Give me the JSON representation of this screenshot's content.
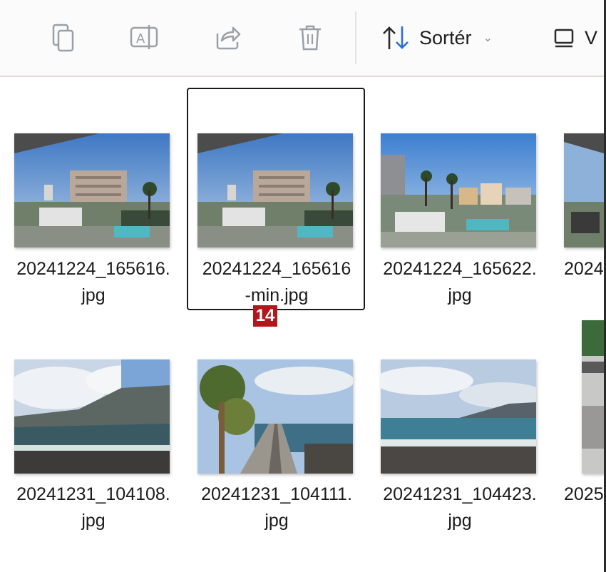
{
  "toolbar": {
    "icons": [
      "copy-icon",
      "rename-icon",
      "share-icon",
      "delete-icon"
    ],
    "sort_label": "Sortér",
    "view_label": "V"
  },
  "files": [
    {
      "line1": "20241224_165616.",
      "line2": "jpg"
    },
    {
      "line1": "20241224_165616",
      "line2": "-min.jpg"
    },
    {
      "line1": "20241224_165622.",
      "line2": "jpg"
    },
    {
      "line1": "2024",
      "line2": ""
    },
    {
      "line1": "20241231_104108.",
      "line2": "jpg"
    },
    {
      "line1": "20241231_104111.",
      "line2": "jpg"
    },
    {
      "line1": "20241231_104423.",
      "line2": "jpg"
    },
    {
      "line1": "2025",
      "line2": ""
    }
  ],
  "badge": "14",
  "colors": {
    "accent": "#b3161b",
    "sort_icon": "#2a6fd6",
    "icon_gray": "#9aa0a6"
  }
}
